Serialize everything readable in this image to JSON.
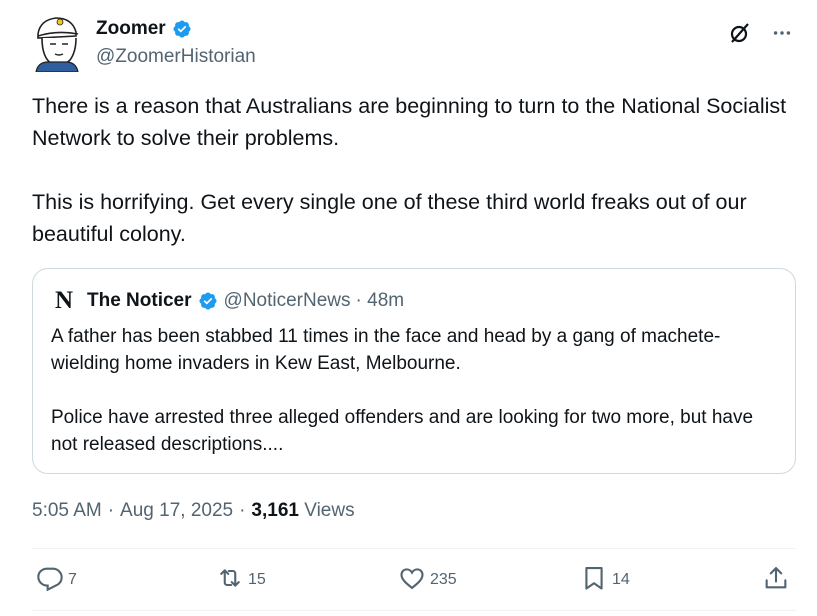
{
  "author": {
    "display_name": "Zoomer",
    "handle": "@ZoomerHistorian",
    "verified": true
  },
  "post": {
    "paragraphs": [
      "There is a reason that Australians are beginning to turn to the National Socialist Network to solve their problems.",
      "This is horrifying. Get every single one of these third world freaks out of our beautiful colony."
    ]
  },
  "quote": {
    "logo_letter": "N",
    "name": "The Noticer",
    "verified": true,
    "handle": "@NoticerNews",
    "time": "· 48m",
    "paragraphs": [
      "A father has been stabbed 11 times in the face and head by a gang of machete-wielding home invaders in Kew East, Melbourne.",
      "Police have arrested three alleged offenders and are looking for two more, but have not released descriptions...."
    ]
  },
  "meta": {
    "time": "5:05 AM",
    "separator": "·",
    "date": "Aug 17, 2025",
    "views_count": "3,161",
    "views_label": "Views"
  },
  "actions": {
    "replies": "7",
    "reposts": "15",
    "likes": "235",
    "bookmarks": "14"
  },
  "colors": {
    "text": "#0f1419",
    "secondary": "#536471",
    "verified_blue": "#1d9bf0",
    "border": "#cfd9de"
  },
  "icons": [
    "verified-badge-icon",
    "grok-icon",
    "more-icon",
    "reply-icon",
    "repost-icon",
    "like-icon",
    "bookmark-icon",
    "share-icon"
  ]
}
